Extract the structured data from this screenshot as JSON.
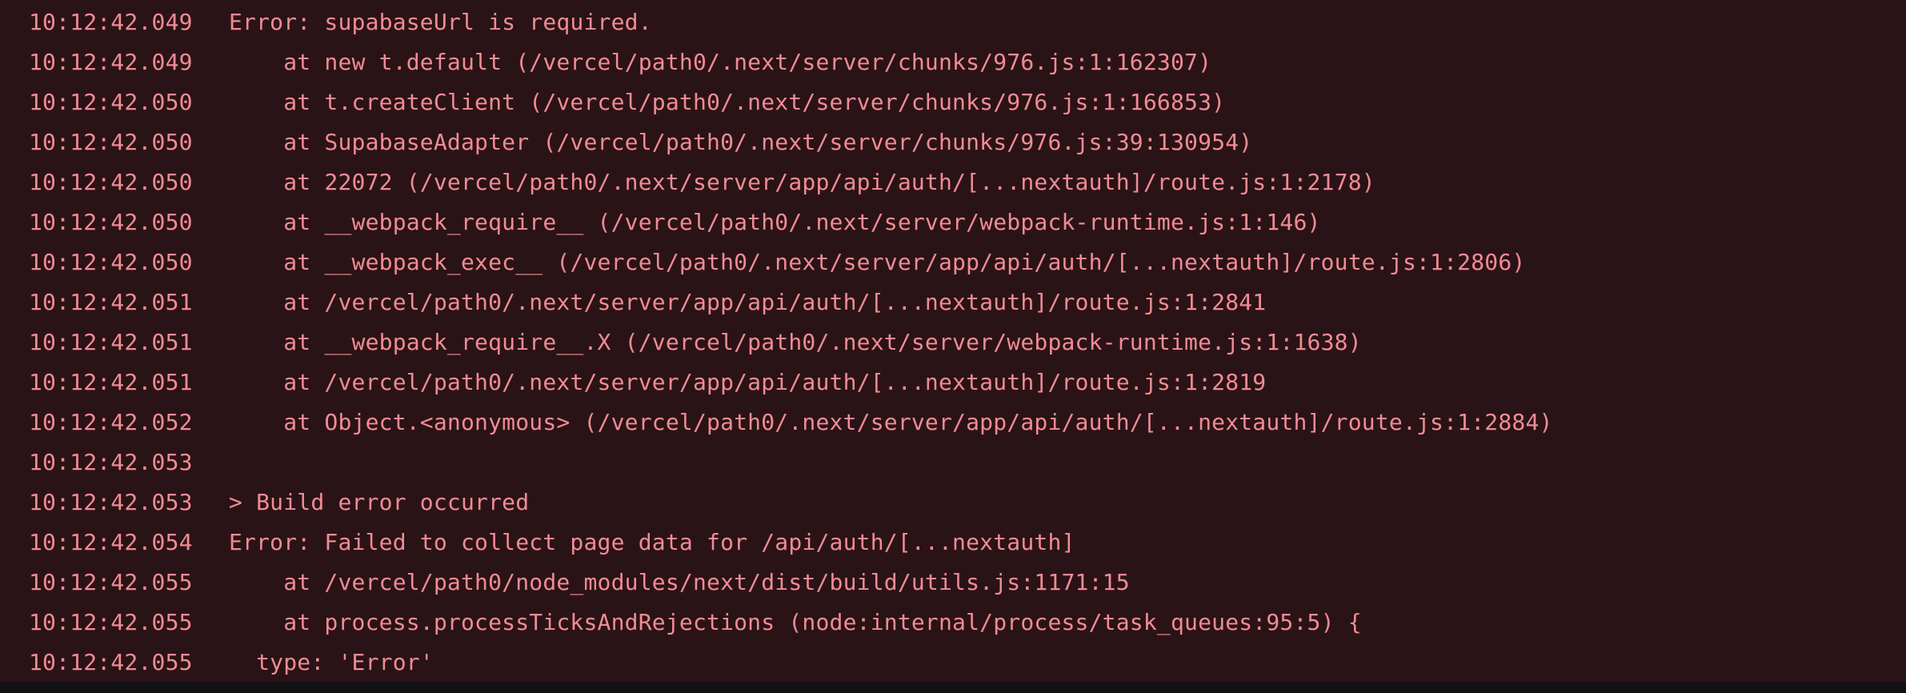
{
  "log": {
    "lines": [
      {
        "ts": "10:12:42.049",
        "msg": "Error: supabaseUrl is required."
      },
      {
        "ts": "10:12:42.049",
        "msg": "    at new t.default (/vercel/path0/.next/server/chunks/976.js:1:162307)"
      },
      {
        "ts": "10:12:42.050",
        "msg": "    at t.createClient (/vercel/path0/.next/server/chunks/976.js:1:166853)"
      },
      {
        "ts": "10:12:42.050",
        "msg": "    at SupabaseAdapter (/vercel/path0/.next/server/chunks/976.js:39:130954)"
      },
      {
        "ts": "10:12:42.050",
        "msg": "    at 22072 (/vercel/path0/.next/server/app/api/auth/[...nextauth]/route.js:1:2178)"
      },
      {
        "ts": "10:12:42.050",
        "msg": "    at __webpack_require__ (/vercel/path0/.next/server/webpack-runtime.js:1:146)"
      },
      {
        "ts": "10:12:42.050",
        "msg": "    at __webpack_exec__ (/vercel/path0/.next/server/app/api/auth/[...nextauth]/route.js:1:2806)"
      },
      {
        "ts": "10:12:42.051",
        "msg": "    at /vercel/path0/.next/server/app/api/auth/[...nextauth]/route.js:1:2841"
      },
      {
        "ts": "10:12:42.051",
        "msg": "    at __webpack_require__.X (/vercel/path0/.next/server/webpack-runtime.js:1:1638)"
      },
      {
        "ts": "10:12:42.051",
        "msg": "    at /vercel/path0/.next/server/app/api/auth/[...nextauth]/route.js:1:2819"
      },
      {
        "ts": "10:12:42.052",
        "msg": "    at Object.<anonymous> (/vercel/path0/.next/server/app/api/auth/[...nextauth]/route.js:1:2884)"
      },
      {
        "ts": "10:12:42.053",
        "msg": ""
      },
      {
        "ts": "10:12:42.053",
        "msg": "> Build error occurred"
      },
      {
        "ts": "10:12:42.054",
        "msg": "Error: Failed to collect page data for /api/auth/[...nextauth]"
      },
      {
        "ts": "10:12:42.055",
        "msg": "    at /vercel/path0/node_modules/next/dist/build/utils.js:1171:15"
      },
      {
        "ts": "10:12:42.055",
        "msg": "    at process.processTicksAndRejections (node:internal/process/task_queues:95:5) {"
      },
      {
        "ts": "10:12:42.055",
        "msg": "  type: 'Error'"
      }
    ]
  },
  "colors": {
    "background": "#2a1316",
    "text": "#f28b96",
    "footer": "#111014"
  }
}
